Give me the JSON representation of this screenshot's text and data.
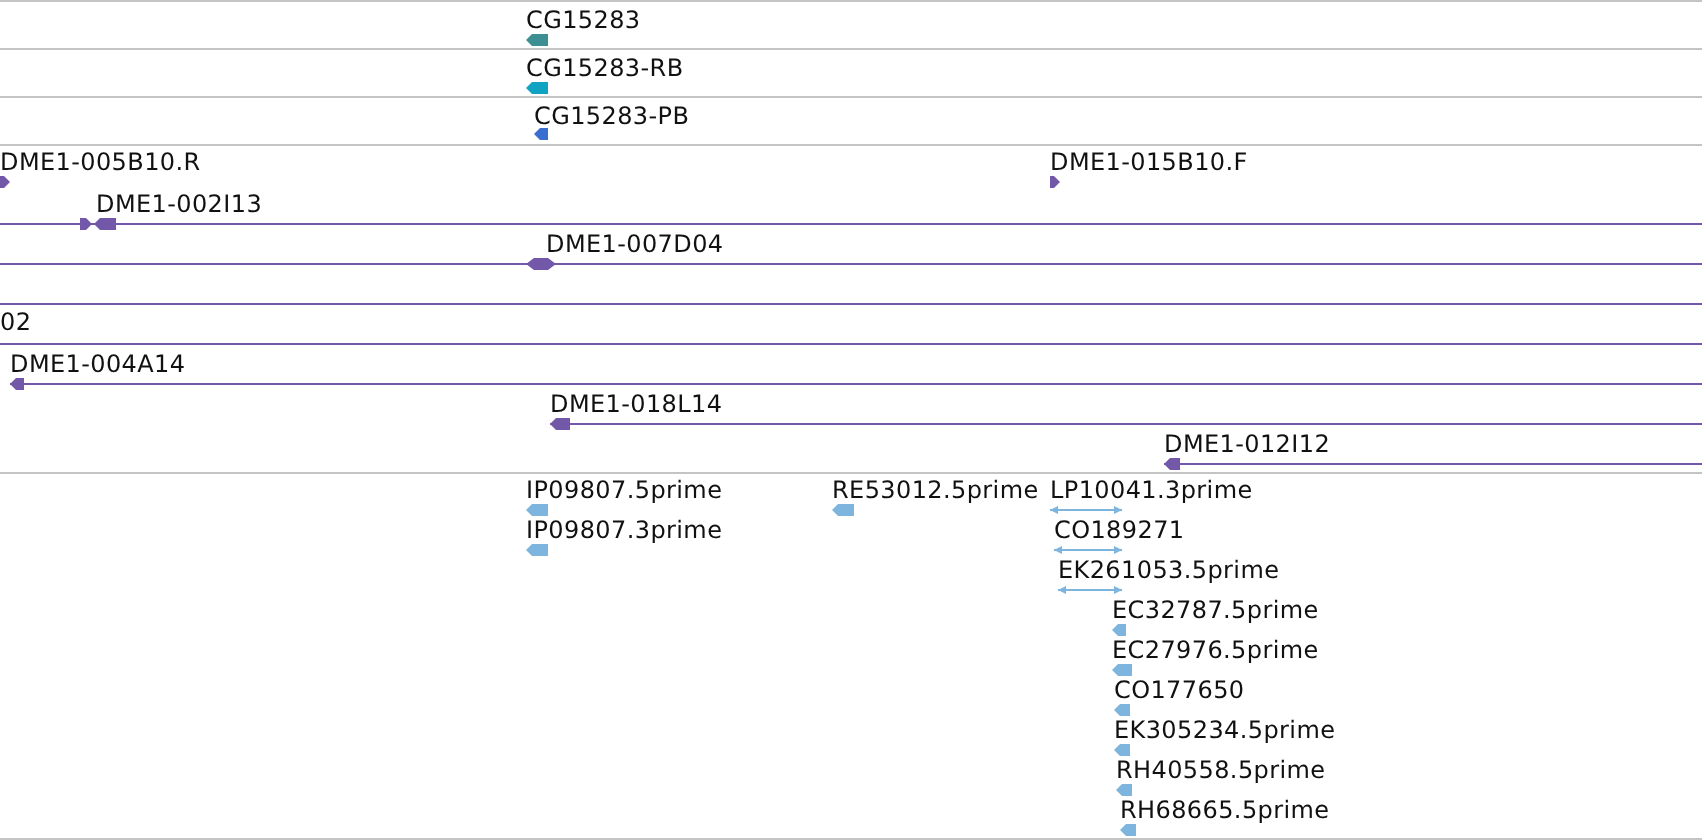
{
  "tracks": [
    {
      "color": "#3d8f94",
      "features": [
        {
          "label": "CG15283",
          "points_left": true,
          "points_right": false
        }
      ]
    },
    {
      "color": "#11a3c4",
      "features": [
        {
          "label": "CG15283-RB",
          "points_left": true,
          "points_right": false
        }
      ]
    },
    {
      "color": "#3a6fd0",
      "features": [
        {
          "label": "CG15283-PB",
          "points_left": true,
          "points_right": false
        }
      ]
    },
    {
      "color": "#7357a8",
      "features": [
        {
          "kind": "block",
          "label": "DME1-005B10.R",
          "points_left": false,
          "points_right": true
        },
        {
          "kind": "block",
          "label": "DME1-015B10.F",
          "points_left": false,
          "points_right": true
        },
        {
          "kind": "block",
          "label": "DME1-002I13",
          "points_left": true,
          "points_right": false
        },
        {
          "kind": "block",
          "label": "DME1-007D04",
          "points_left": true,
          "points_right": true
        },
        {
          "kind": "line"
        },
        {
          "kind": "line",
          "label": "02"
        },
        {
          "kind": "block",
          "label": "DME1-004A14",
          "points_left": true,
          "points_right": false
        },
        {
          "kind": "block",
          "label": "DME1-018L14",
          "points_left": true,
          "points_right": false
        },
        {
          "kind": "block",
          "label": "DME1-012I12",
          "points_left": true,
          "points_right": false
        }
      ]
    },
    {
      "color": "#7db5de",
      "features": [
        {
          "label": "IP09807.5prime",
          "points_left": true,
          "points_right": false
        },
        {
          "label": "IP09807.3prime",
          "points_left": true,
          "points_right": false
        },
        {
          "label": "RE53012.5prime",
          "points_left": true,
          "points_right": false
        },
        {
          "label": "LP10041.3prime",
          "points_left": true,
          "points_right": true
        },
        {
          "label": "CO189271",
          "points_left": true,
          "points_right": true
        },
        {
          "label": "EK261053.5prime",
          "points_left": true,
          "points_right": true
        },
        {
          "label": "EC32787.5prime",
          "points_left": true,
          "points_right": false
        },
        {
          "label": "EC27976.5prime",
          "points_left": true,
          "points_right": false
        },
        {
          "label": "CO177650",
          "points_left": true,
          "points_right": false
        },
        {
          "label": "EK305234.5prime",
          "points_left": true,
          "points_right": false
        },
        {
          "label": "RH40558.5prime",
          "points_left": true,
          "points_right": false
        },
        {
          "label": "RH68665.5prime",
          "points_left": true,
          "points_right": false
        }
      ]
    }
  ]
}
